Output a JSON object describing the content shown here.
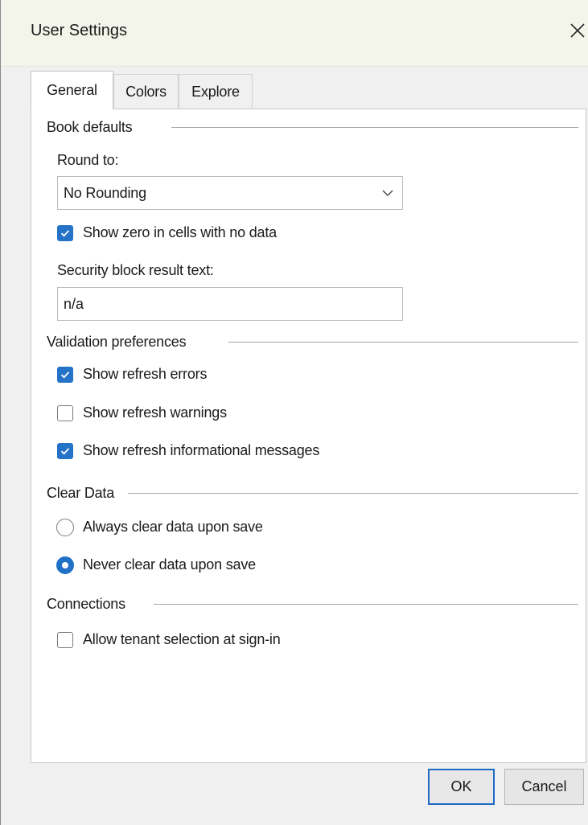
{
  "window": {
    "title": "User Settings",
    "close_icon": "close-icon"
  },
  "tabs": [
    {
      "label": "General",
      "active": true
    },
    {
      "label": "Colors",
      "active": false
    },
    {
      "label": "Explore",
      "active": false
    }
  ],
  "book_defaults": {
    "group_label": "Book defaults",
    "round_to_label": "Round to:",
    "round_to_value": "No Rounding",
    "show_zero_label": "Show zero in cells with no data",
    "show_zero_checked": true,
    "security_label": "Security block result text:",
    "security_value": "n/a"
  },
  "validation": {
    "group_label": "Validation preferences",
    "items": [
      {
        "label": "Show refresh errors",
        "checked": true
      },
      {
        "label": "Show refresh warnings",
        "checked": false
      },
      {
        "label": "Show refresh informational messages",
        "checked": true
      }
    ]
  },
  "clear_data": {
    "group_label": "Clear Data",
    "options": [
      {
        "label": "Always clear data upon save",
        "selected": false
      },
      {
        "label": "Never clear data upon save",
        "selected": true
      }
    ]
  },
  "connections": {
    "group_label": "Connections",
    "allow_tenant_label": "Allow tenant selection at sign-in",
    "allow_tenant_checked": false
  },
  "buttons": {
    "ok": "OK",
    "cancel": "Cancel"
  },
  "colors": {
    "accent": "#2573c8",
    "title_bar": "#f3f5ea",
    "dialog_bg": "#f0f0f0"
  }
}
